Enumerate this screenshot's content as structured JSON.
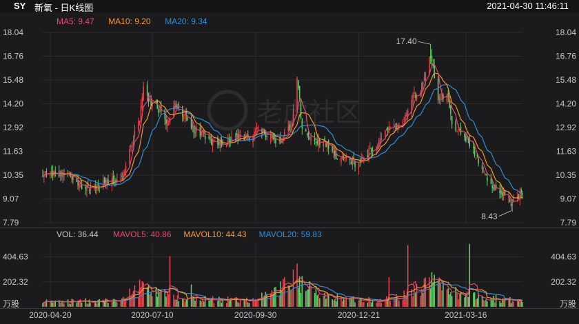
{
  "header": {
    "symbol": "SY",
    "name": "新氧 - 日K线图",
    "datetime": "2021-04-30 11:46:11"
  },
  "watermark": "老虎社区",
  "colors": {
    "up": "#e8474d",
    "down": "#63d06a",
    "ma5": "#e04c6e",
    "ma10": "#f39a2d",
    "ma20": "#2e8fd6",
    "background": "#1b1b1d",
    "grid": "#2c2c2e"
  },
  "chart_data": [
    {
      "type": "candlestick",
      "name": "price",
      "y_ticks": [
        "18.04",
        "16.76",
        "15.48",
        "14.20",
        "12.92",
        "11.63",
        "10.35",
        "9.07",
        "7.79"
      ],
      "ylim": [
        7.79,
        18.04
      ],
      "legend": [
        {
          "key": "ma5",
          "label": "MA5: 9.47"
        },
        {
          "key": "ma10",
          "label": "MA10: 9.20"
        },
        {
          "key": "ma20",
          "label": "MA20: 9.34"
        }
      ],
      "annotations": [
        {
          "label": "17.40",
          "date": "2021-02-16",
          "value": 17.4
        },
        {
          "label": "8.43",
          "date": "2021-04-21",
          "value": 8.43
        }
      ],
      "close_keypoints": [
        [
          "2020-04-14",
          10.4
        ],
        [
          "2020-04-20",
          10.35
        ],
        [
          "2020-05-04",
          10.45
        ],
        [
          "2020-05-20",
          9.55
        ],
        [
          "2020-06-02",
          10.05
        ],
        [
          "2020-06-16",
          10.1
        ],
        [
          "2020-06-23",
          11.9
        ],
        [
          "2020-06-30",
          13.4
        ],
        [
          "2020-07-03",
          14.9
        ],
        [
          "2020-07-08",
          14.3
        ],
        [
          "2020-07-15",
          13.9
        ],
        [
          "2020-07-21",
          13.2
        ],
        [
          "2020-07-28",
          14.2
        ],
        [
          "2020-08-04",
          13.6
        ],
        [
          "2020-08-11",
          12.9
        ],
        [
          "2020-08-18",
          12.6
        ],
        [
          "2020-08-25",
          12.2
        ],
        [
          "2020-09-01",
          12.0
        ],
        [
          "2020-09-10",
          12.3
        ],
        [
          "2020-09-18",
          12.5
        ],
        [
          "2020-09-25",
          12.3
        ],
        [
          "2020-10-02",
          12.8
        ],
        [
          "2020-10-12",
          12.4
        ],
        [
          "2020-10-20",
          12.1
        ],
        [
          "2020-10-29",
          13.2
        ],
        [
          "2020-11-02",
          15.8
        ],
        [
          "2020-11-06",
          12.9
        ],
        [
          "2020-11-16",
          12.3
        ],
        [
          "2020-11-25",
          12.0
        ],
        [
          "2020-12-03",
          11.4
        ],
        [
          "2020-12-11",
          11.2
        ],
        [
          "2020-12-18",
          11.0
        ],
        [
          "2020-12-28",
          11.5
        ],
        [
          "2021-01-05",
          12.0
        ],
        [
          "2021-01-12",
          12.8
        ],
        [
          "2021-01-20",
          13.0
        ],
        [
          "2021-01-27",
          13.6
        ],
        [
          "2021-02-03",
          14.6
        ],
        [
          "2021-02-10",
          15.2
        ],
        [
          "2021-02-16",
          16.8
        ],
        [
          "2021-02-22",
          14.6
        ],
        [
          "2021-03-01",
          14.7
        ],
        [
          "2021-03-05",
          13.2
        ],
        [
          "2021-03-10",
          12.8
        ],
        [
          "2021-03-16",
          12.4
        ],
        [
          "2021-03-23",
          11.5
        ],
        [
          "2021-03-29",
          10.6
        ],
        [
          "2021-04-06",
          9.8
        ],
        [
          "2021-04-13",
          9.4
        ],
        [
          "2021-04-21",
          8.9
        ],
        [
          "2021-04-27",
          9.4
        ],
        [
          "2021-04-30",
          9.4
        ]
      ],
      "x_ticks": [
        "2020-04-20",
        "2020-07-10",
        "2020-09-30",
        "2020-12-21",
        "2021-03-16"
      ]
    },
    {
      "type": "bar",
      "name": "volume",
      "y_ticks": [
        "404.63",
        "202.32"
      ],
      "unit": "万股",
      "ylim": [
        0,
        520
      ],
      "legend": [
        {
          "key": "vol",
          "label": "VOL: 36.44"
        },
        {
          "key": "ma5",
          "label": "MAVOL5: 40.86"
        },
        {
          "key": "ma10",
          "label": "MAVOL10: 44.43"
        },
        {
          "key": "ma20",
          "label": "MAVOL20: 59.83"
        }
      ],
      "volume_keypoints": [
        [
          "2020-04-14",
          40
        ],
        [
          "2020-06-15",
          50
        ],
        [
          "2020-06-30",
          160
        ],
        [
          "2020-07-10",
          120
        ],
        [
          "2020-08-01",
          70
        ],
        [
          "2020-09-01",
          55
        ],
        [
          "2020-10-01",
          60
        ],
        [
          "2020-11-02",
          220
        ],
        [
          "2020-11-20",
          90
        ],
        [
          "2020-12-20",
          60
        ],
        [
          "2021-01-20",
          60
        ],
        [
          "2021-02-16",
          200
        ],
        [
          "2021-03-01",
          130
        ],
        [
          "2021-03-16",
          100
        ],
        [
          "2021-04-01",
          80
        ],
        [
          "2021-04-30",
          40
        ]
      ],
      "spikes": [
        [
          "2020-06-30",
          220
        ],
        [
          "2020-07-24",
          410
        ],
        [
          "2020-08-10",
          180
        ],
        [
          "2020-10-23",
          240
        ],
        [
          "2020-11-02",
          350
        ],
        [
          "2021-01-14",
          240
        ],
        [
          "2021-01-29",
          500
        ],
        [
          "2021-02-17",
          280
        ],
        [
          "2021-03-19",
          510
        ]
      ]
    }
  ]
}
